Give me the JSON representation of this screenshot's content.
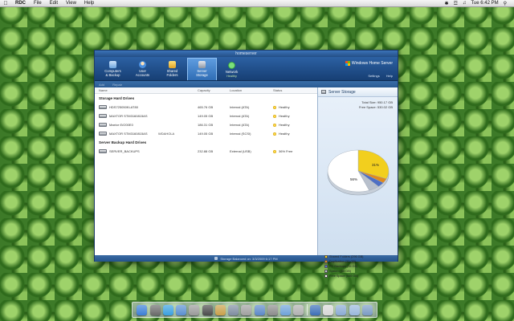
{
  "menubar": {
    "app": "RDC",
    "items": [
      "File",
      "Edit",
      "View",
      "Help"
    ],
    "clock": "Tue 6:42 PM"
  },
  "window": {
    "title": "homeserver",
    "brand": "Windows Home Server",
    "links": {
      "settings": "Settings",
      "help": "Help"
    },
    "tabs": [
      {
        "label1": "Computers",
        "label2": "& Backup",
        "icon": "computers-icon"
      },
      {
        "label1": "User",
        "label2": "Accounts",
        "icon": "users-icon"
      },
      {
        "label1": "Shared",
        "label2": "Folders",
        "icon": "folder-icon"
      },
      {
        "label1": "Server",
        "label2": "Storage",
        "icon": "disk-icon"
      },
      {
        "label1": "Network",
        "label2": "Healthy",
        "icon": "network-icon"
      }
    ],
    "toolbar": {
      "add": "Add",
      "repair": "Repair"
    },
    "columns": {
      "name": "Name",
      "capacity": "Capacity",
      "location": "Location",
      "status": "Status"
    },
    "storage_section": "Storage Hard Drives",
    "drives": [
      {
        "name": "HDS725050KLAT80",
        "label": "",
        "capacity": "465.76 GB",
        "location": "Internal (ATA)",
        "status": "Healthy"
      },
      {
        "name": "MAXTOR STM3160815AS",
        "label": "",
        "capacity": "149.05 GB",
        "location": "Internal (ATA)",
        "status": "Healthy"
      },
      {
        "name": "Maxtor 6V200E0",
        "label": "",
        "capacity": "186.31 GB",
        "location": "Internal (ATA)",
        "status": "Healthy"
      },
      {
        "name": "MAXTOR STM3160815AS",
        "label": "WDAHOLA",
        "capacity": "149.05 GB",
        "location": "Internal (SCSI)",
        "status": "Healthy"
      }
    ],
    "backup_section": "Server Backup Hard Drives",
    "backup_drives": [
      {
        "name": "SERVER_BACKUPS",
        "capacity": "232.88 GB",
        "location": "External (USB)",
        "status": "36% Free"
      }
    ],
    "side": {
      "title": "Server Storage",
      "total_size": "Total Size: 950.17 GB",
      "free_space": "Free Space: 530.02 GB",
      "pie_labels": {
        "shared": "31%",
        "free": "56%"
      },
      "legend": [
        {
          "label": "Shared Folders (296 GB)",
          "color": "#f2cf1e"
        },
        {
          "label": "Duplication (33 GB)",
          "color": "#e08a1e"
        },
        {
          "label": "PC Backups (35 GB)",
          "color": "#4e6fc4"
        },
        {
          "label": "System (55 GB)",
          "color": "#b8c0cc"
        },
        {
          "label": "Free Space (530 GB)",
          "color": "#ffffff"
        }
      ]
    },
    "status_text": "Storage Balanced on: 3/3/2009 6:17 PM"
  },
  "chart_data": {
    "type": "pie",
    "labels": [
      "Shared Folders",
      "Duplication",
      "PC Backups",
      "System",
      "Free Space"
    ],
    "values": [
      296,
      33,
      35,
      55,
      530
    ],
    "units": "GB"
  },
  "dock": {
    "colors": [
      "#3c7fd6",
      "#6b6b6b",
      "#3aa0e0",
      "#5a8fd0",
      "#9a9a9a",
      "#4c4c4c",
      "#c9a04a",
      "#7f8da0",
      "#a0a0a0",
      "#5c88c8",
      "#8c8c8c",
      "#6fa2d8",
      "#b0b0b0",
      "#3d6fb8",
      "#d8d8d8",
      "#8aaad4",
      "#9ab8dc",
      "#7b9bc4"
    ]
  }
}
